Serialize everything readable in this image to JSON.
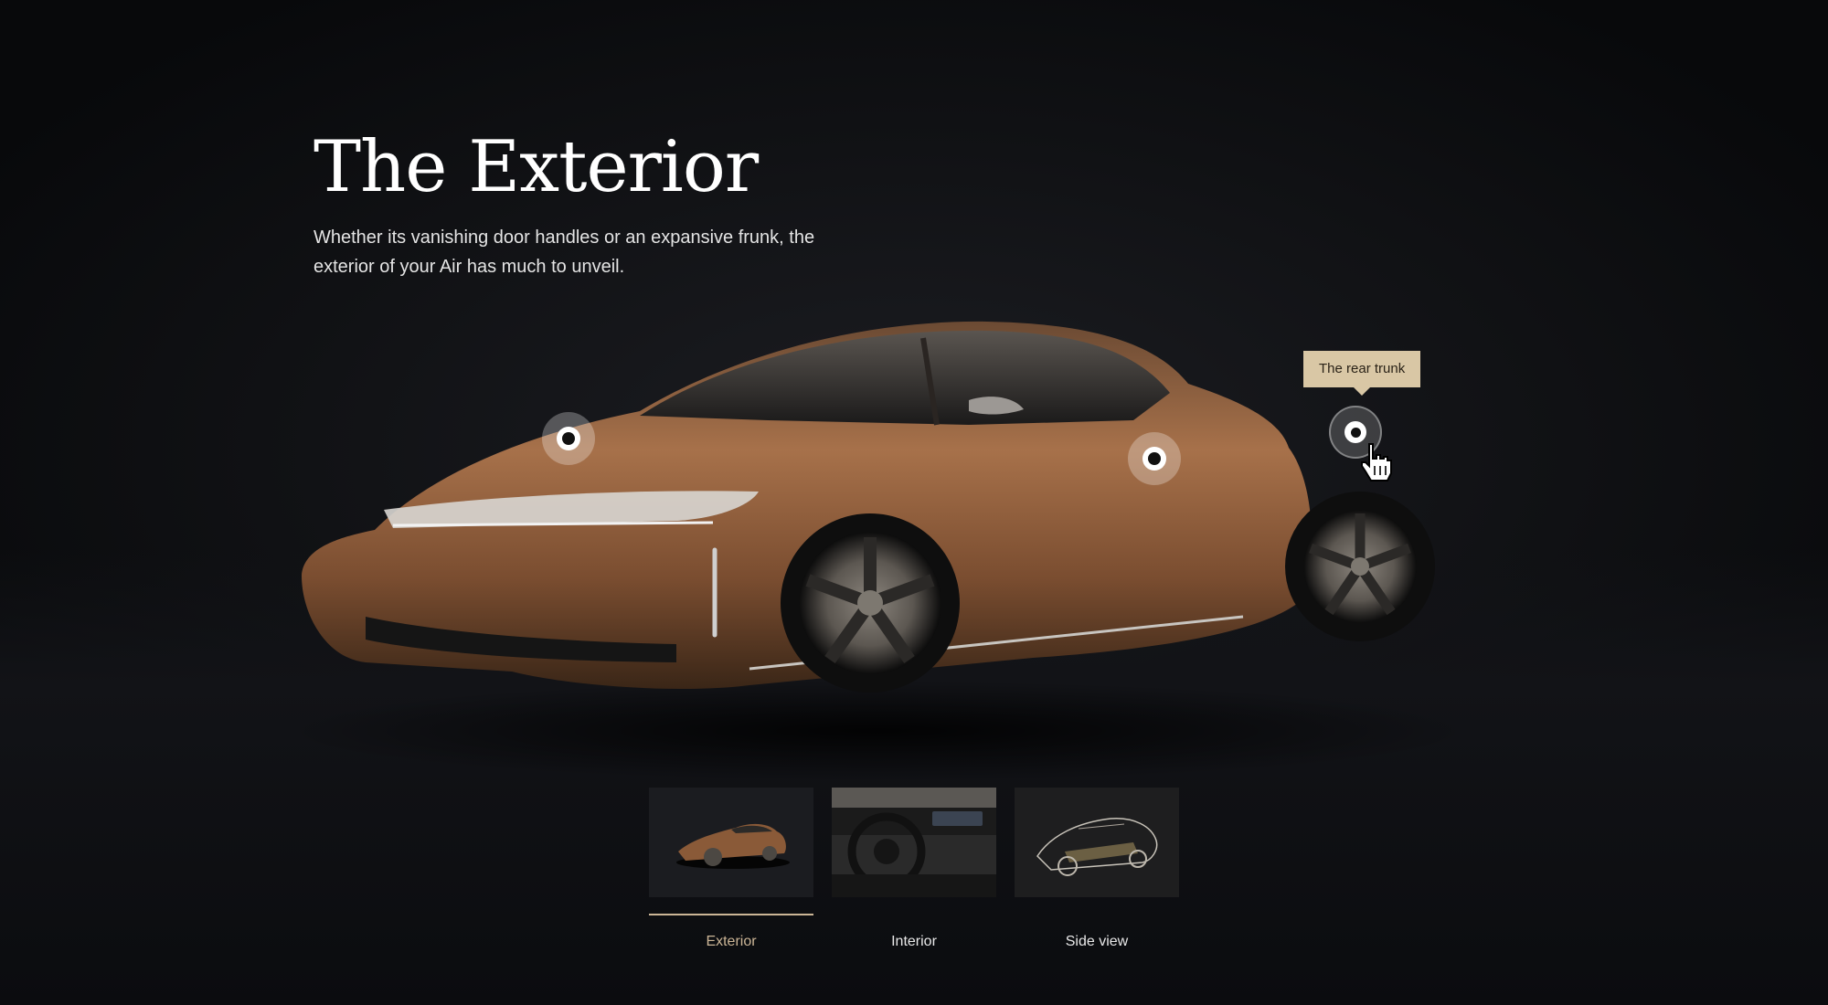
{
  "section": {
    "title": "The Exterior",
    "description": "Whether its vanishing door handles or an expansive frunk, the exterior of your Air has much to unveil."
  },
  "hotspots": {
    "tooltip": "The rear trunk"
  },
  "gallery": {
    "items": [
      {
        "label": "Exterior",
        "icon": "car-exterior-thumbnail",
        "active": true
      },
      {
        "label": "Interior",
        "icon": "car-interior-thumbnail",
        "active": false
      },
      {
        "label": "Side view",
        "icon": "car-xray-thumbnail",
        "active": false
      }
    ]
  },
  "colors": {
    "background": "#111215",
    "car_paint": "#8a5a38",
    "accent": "#cbb596",
    "tooltip_bg": "#d9c7a5"
  }
}
